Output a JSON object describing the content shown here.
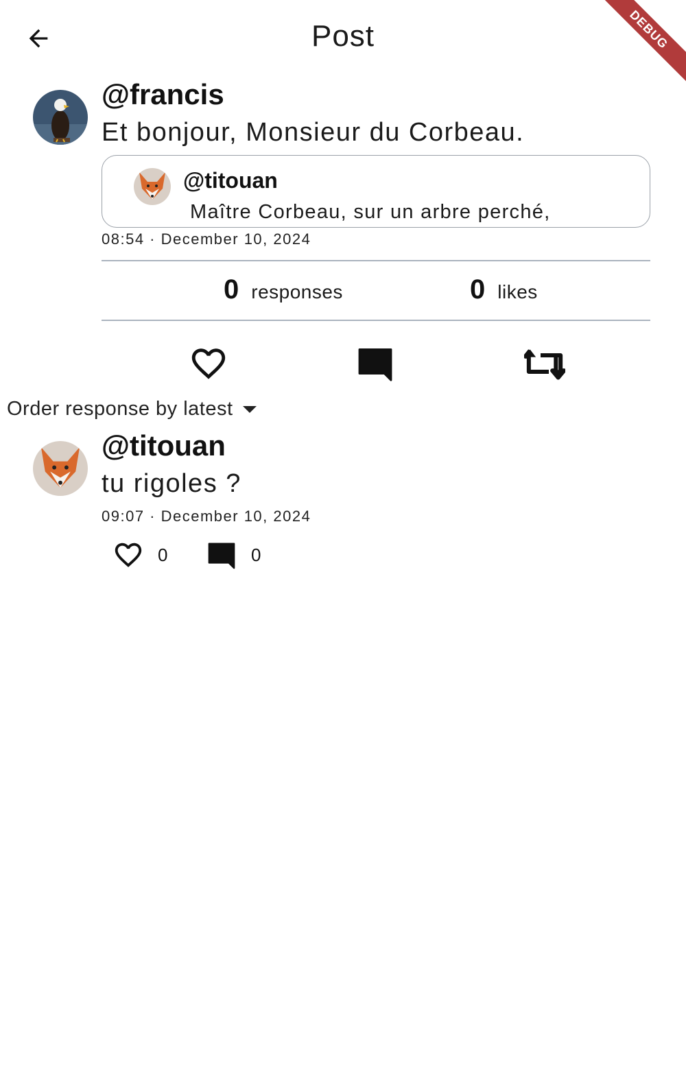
{
  "app_bar": {
    "title": "Post"
  },
  "debug_banner": "DEBUG",
  "post": {
    "username": "@francis",
    "text": "Et bonjour, Monsieur du Corbeau.",
    "quoted": {
      "username": "@titouan",
      "text": "Maître Corbeau, sur un arbre perché,"
    },
    "timestamp": "08:54 · December 10, 2024",
    "stats": {
      "responses_count": "0",
      "responses_label": "responses",
      "likes_count": "0",
      "likes_label": "likes"
    },
    "actions": [
      "heart-outline-icon",
      "comment-icon",
      "repost-icon"
    ]
  },
  "order_select": {
    "label": "Order response by latest"
  },
  "responses": [
    {
      "username": "@titouan",
      "text": "tu rigoles ?",
      "timestamp": "09:07 · December 10, 2024",
      "likes": "0",
      "comments": "0"
    }
  ],
  "colors": {
    "debug": "#b13b3b",
    "divider": "#aab3be",
    "text": "#111111"
  }
}
